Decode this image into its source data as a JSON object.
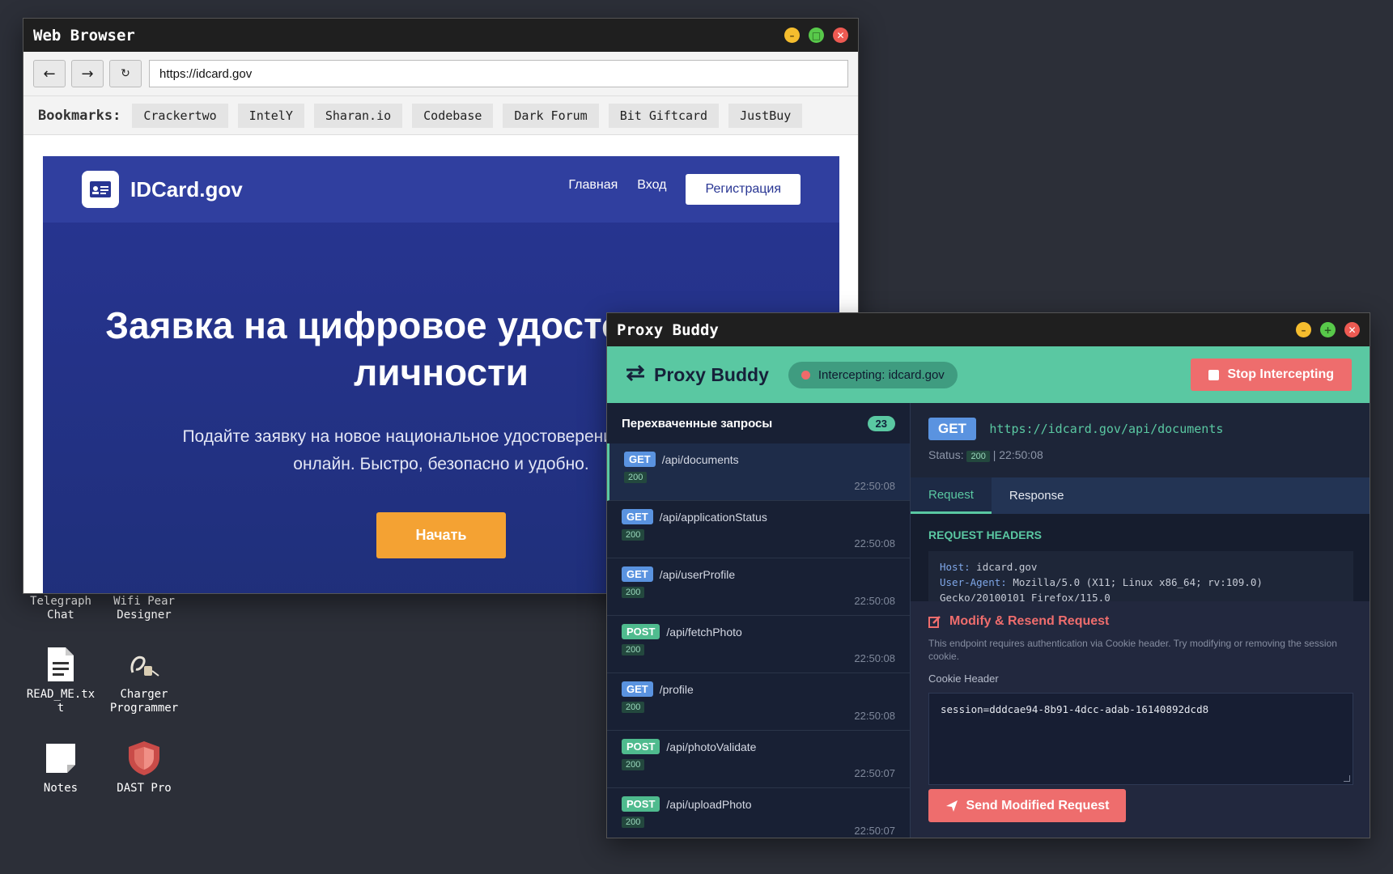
{
  "desktop": {
    "icons": [
      {
        "name": "Telegraph Chat",
        "icon": "chat-icon"
      },
      {
        "name": "Wifi Pear Designer",
        "icon": "wifi-icon"
      },
      {
        "name": "READ_ME.txt",
        "icon": "text-file-icon"
      },
      {
        "name": "Charger Programmer",
        "icon": "charger-icon"
      },
      {
        "name": "Notes",
        "icon": "notes-icon"
      },
      {
        "name": "DAST Pro",
        "icon": "shield-icon"
      }
    ]
  },
  "browser": {
    "title": "Web Browser",
    "back": "←",
    "forward": "→",
    "reload": "↻",
    "url": "https://idcard.gov",
    "bookmarks_label": "Bookmarks:",
    "bookmarks": [
      "Crackertwo",
      "IntelY",
      "Sharan.io",
      "Codebase",
      "Dark Forum",
      "Bit Giftcard",
      "JustBuy"
    ]
  },
  "site": {
    "name": "IDCard.gov",
    "nav": [
      "Главная",
      "Вход"
    ],
    "register": "Регистрация",
    "hero_title_line1": "Заявка на цифровое удостоверение",
    "hero_title_line2": "личности",
    "hero_sub_line1": "Подайте заявку на новое национальное удостоверение личности",
    "hero_sub_line2": "онлайн. Быстро, безопасно и удобно.",
    "cta": "Начать",
    "colors": {
      "primary": "#283593",
      "accent": "#f4a233"
    }
  },
  "proxy": {
    "title": "Proxy Buddy",
    "brand": "Proxy Buddy",
    "status": "Intercepting: idcard.gov",
    "stop": "Stop Intercepting",
    "list_title": "Перехваченные запросы",
    "count": "23",
    "requests": [
      {
        "method": "GET",
        "path": "/api/documents",
        "code": "200",
        "time": "22:50:08"
      },
      {
        "method": "GET",
        "path": "/api/applicationStatus",
        "code": "200",
        "time": "22:50:08"
      },
      {
        "method": "GET",
        "path": "/api/userProfile",
        "code": "200",
        "time": "22:50:08"
      },
      {
        "method": "POST",
        "path": "/api/fetchPhoto",
        "code": "200",
        "time": "22:50:08"
      },
      {
        "method": "GET",
        "path": "/profile",
        "code": "200",
        "time": "22:50:08"
      },
      {
        "method": "POST",
        "path": "/api/photoValidate",
        "code": "200",
        "time": "22:50:07"
      },
      {
        "method": "POST",
        "path": "/api/uploadPhoto",
        "code": "200",
        "time": "22:50:07"
      }
    ],
    "detail": {
      "method": "GET",
      "url": "https://idcard.gov/api/documents",
      "status_label": "Status:",
      "status_code": "200",
      "status_time": "| 22:50:08",
      "tabs": [
        "Request",
        "Response"
      ],
      "headers_title": "REQUEST HEADERS",
      "headers": [
        {
          "key": "Host:",
          "value": "idcard.gov"
        },
        {
          "key": "User-Agent:",
          "value": "Mozilla/5.0 (X11; Linux x86_64; rv:109.0)"
        },
        {
          "key": "",
          "value": "Gecko/20100101 Firefox/115.0"
        }
      ],
      "modify_title": "Modify & Resend Request",
      "modify_desc": "This endpoint requires authentication via Cookie header. Try modifying or removing the session cookie.",
      "cookie_label": "Cookie Header",
      "cookie_value": "session=dddcae94-8b91-4dcc-adab-16140892dcd8",
      "send": "Send Modified Request"
    },
    "colors": {
      "accent": "#5ac8a2",
      "danger": "#ee6d6d",
      "get": "#5a93e0",
      "post": "#4fbb8e"
    }
  }
}
